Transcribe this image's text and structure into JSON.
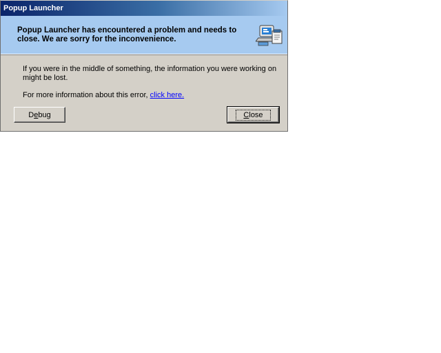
{
  "window": {
    "title": "Popup Launcher"
  },
  "header": {
    "message": "Popup Launcher has encountered a problem and needs to close.  We are sorry for the inconvenience.",
    "icon": "error-report-computer-icon"
  },
  "body": {
    "paragraph1": "If you were in the middle of something, the information you were working on might be lost.",
    "paragraph2_prefix": "For more information about this error, ",
    "link_text": "click here."
  },
  "buttons": {
    "debug_first": "D",
    "debug_mnemonic": "e",
    "debug_rest": "bug",
    "close_mnemonic": "C",
    "close_rest": "lose"
  },
  "colors": {
    "titlebar_start": "#0a246a",
    "header_bg": "#a6caf0",
    "dialog_bg": "#d4d0c8",
    "link": "#0000ff"
  }
}
